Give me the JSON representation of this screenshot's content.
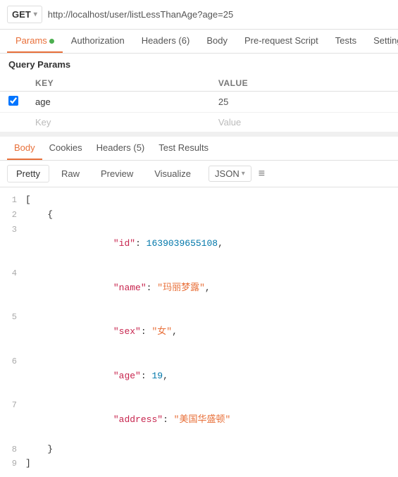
{
  "url_bar": {
    "method": "GET",
    "chevron": "▾",
    "url": "http://localhost/user/listLessThanAge?age=25"
  },
  "top_tabs": [
    {
      "id": "params",
      "label": "Params",
      "active": true,
      "dot": true
    },
    {
      "id": "authorization",
      "label": "Authorization",
      "active": false
    },
    {
      "id": "headers",
      "label": "Headers (6)",
      "active": false
    },
    {
      "id": "body",
      "label": "Body",
      "active": false
    },
    {
      "id": "pre-request",
      "label": "Pre-request Script",
      "active": false
    },
    {
      "id": "tests",
      "label": "Tests",
      "active": false
    },
    {
      "id": "settings",
      "label": "Setting",
      "active": false
    }
  ],
  "query_params": {
    "section_label": "Query Params",
    "col_key": "KEY",
    "col_value": "VALUE",
    "rows": [
      {
        "checked": true,
        "key": "age",
        "value": "25"
      }
    ],
    "placeholder_row": {
      "key": "Key",
      "value": "Value"
    }
  },
  "body_section": {
    "tabs": [
      {
        "id": "body",
        "label": "Body",
        "active": true
      },
      {
        "id": "cookies",
        "label": "Cookies",
        "active": false
      },
      {
        "id": "headers5",
        "label": "Headers (5)",
        "active": false
      },
      {
        "id": "test-results",
        "label": "Test Results",
        "active": false
      }
    ],
    "format_tabs": [
      {
        "id": "pretty",
        "label": "Pretty",
        "active": true
      },
      {
        "id": "raw",
        "label": "Raw",
        "active": false
      },
      {
        "id": "preview",
        "label": "Preview",
        "active": false
      },
      {
        "id": "visualize",
        "label": "Visualize",
        "active": false
      }
    ],
    "json_label": "JSON",
    "chevron": "▾",
    "wrap_symbol": "≡",
    "lines": [
      {
        "num": 1,
        "content": "[",
        "type": "bracket"
      },
      {
        "num": 2,
        "content": "    {",
        "type": "bracket"
      },
      {
        "num": 3,
        "key": "\"id\"",
        "sep": ": ",
        "value": "1639039655108",
        "value_type": "num",
        "suffix": ","
      },
      {
        "num": 4,
        "key": "\"name\"",
        "sep": ": ",
        "value": "\"玛丽梦露\"",
        "value_type": "str",
        "suffix": ","
      },
      {
        "num": 5,
        "key": "\"sex\"",
        "sep": ": ",
        "value": "\"女\"",
        "value_type": "str",
        "suffix": ","
      },
      {
        "num": 6,
        "key": "\"age\"",
        "sep": ": ",
        "value": "19",
        "value_type": "num",
        "suffix": ","
      },
      {
        "num": 7,
        "key": "\"address\"",
        "sep": ": ",
        "value": "\"美国华盛顿\"",
        "value_type": "str",
        "suffix": ""
      },
      {
        "num": 8,
        "content": "    }",
        "type": "bracket"
      },
      {
        "num": 9,
        "content": "]",
        "type": "bracket"
      }
    ]
  }
}
